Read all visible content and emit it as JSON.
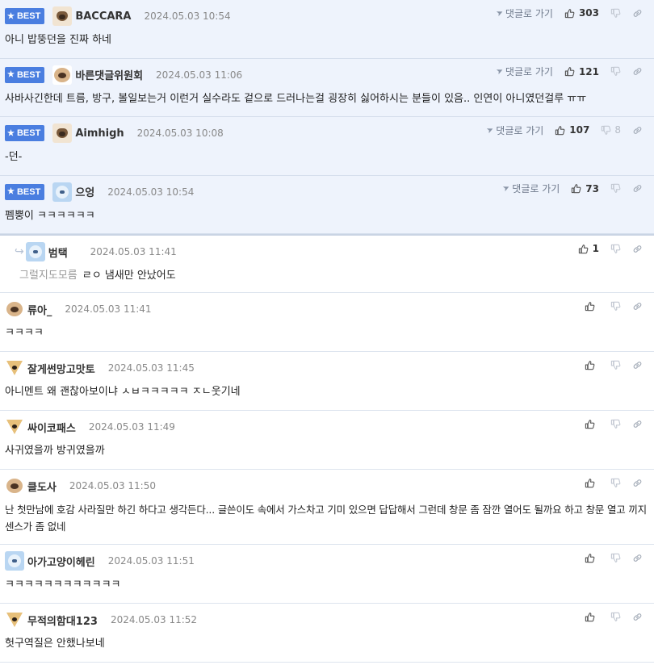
{
  "labels": {
    "best": "BEST",
    "goto": "댓글로 가기"
  },
  "colors": {
    "best_badge": "#4a7ee0",
    "best_row_bg": "#eef3fc"
  },
  "comments": [
    {
      "best": true,
      "avatar": "pug-avatar",
      "nick": "BACCARA",
      "date": "2024.05.03 10:54",
      "likes": "303",
      "dislikes": "",
      "text": "아니 밥뚱던을 진짜 하네"
    },
    {
      "best": true,
      "avatar": "round-puppy-avatar",
      "nick": "바른댓글위원회",
      "date": "2024.05.03 11:06",
      "likes": "121",
      "dislikes": "",
      "text": "사바사긴한데 트름, 방구, 볼일보는거 이런거 실수라도 겉으로 드러나는걸 굉장히 싫어하시는 분들이 있음.. 인연이 아니였던걸루 ㅠㅠ"
    },
    {
      "best": true,
      "avatar": "pug-avatar",
      "nick": "Aimhigh",
      "date": "2024.05.03 10:08",
      "likes": "107",
      "dislikes": "8",
      "text": "-던-"
    },
    {
      "best": true,
      "avatar": "blue-avatar",
      "nick": "으엉",
      "date": "2024.05.03 10:54",
      "likes": "73",
      "dislikes": "",
      "text": "펨뿡이 ㅋㅋㅋㅋㅋㅋ"
    },
    {
      "reply": true,
      "avatar": "blue-avatar",
      "nick": "범택",
      "date": "2024.05.03 11:41",
      "likes": "1",
      "mention": "그럴지도모름",
      "text": "ㄹㅇ 냄새만 안났어도"
    },
    {
      "avatar": "round-puppy-avatar",
      "nick": "류아_",
      "date": "2024.05.03 11:41",
      "text": "ㅋㅋㅋㅋ"
    },
    {
      "avatar": "fox-avatar",
      "nick": "잘게썬망고맛토",
      "date": "2024.05.03 11:45",
      "text": "아니멘트 왜 괜찮아보이냐 ㅅㅂㅋㅋㅋㅋㅋ ㅈㄴ웃기네"
    },
    {
      "avatar": "fox-avatar",
      "nick": "싸이코패스",
      "date": "2024.05.03 11:49",
      "text": "사귀였을까 방귀였을까"
    },
    {
      "avatar": "round-puppy-avatar",
      "nick": "클도사",
      "date": "2024.05.03 11:50",
      "text": "난 첫만남에 호감 사라질만 하긴 하다고 생각든다... 글쓴이도 속에서 가스차고 기미 있으면 답답해서 그런데 창문 좀 잠깐 열어도 될까요 하고 창문 열고 끼지 센스가 좀 없네"
    },
    {
      "avatar": "blue-avatar",
      "nick": "아가고양이헤린",
      "date": "2024.05.03 11:51",
      "text": "ㅋㅋㅋㅋㅋㅋㅋㅋㅋㅋㅋㅋ"
    },
    {
      "avatar": "fox-avatar",
      "nick": "무적의함대123",
      "date": "2024.05.03 11:52",
      "text": "헛구역질은 안했나보네"
    }
  ]
}
